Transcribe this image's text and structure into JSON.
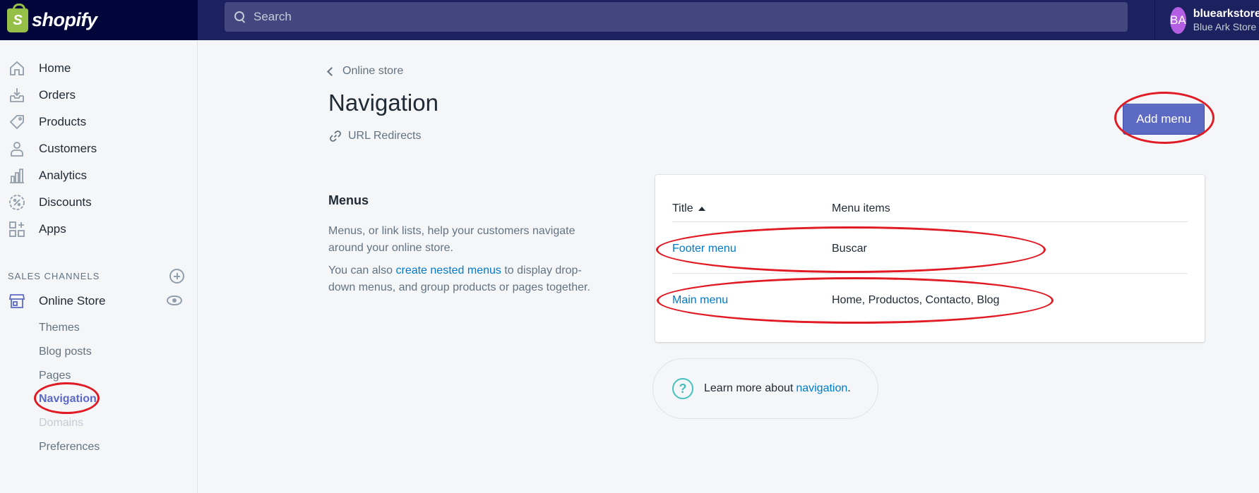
{
  "topbar": {
    "logo_letter": "S",
    "logo_text": "shopify",
    "search_placeholder": "Search",
    "account": {
      "initials": "BA",
      "name": "bluearkstore",
      "store": "Blue Ark Store"
    }
  },
  "sidebar": {
    "items": [
      {
        "label": "Home",
        "icon": "home-icon"
      },
      {
        "label": "Orders",
        "icon": "orders-icon"
      },
      {
        "label": "Products",
        "icon": "tag-icon"
      },
      {
        "label": "Customers",
        "icon": "person-icon"
      },
      {
        "label": "Analytics",
        "icon": "bar-chart-icon"
      },
      {
        "label": "Discounts",
        "icon": "discount-icon"
      },
      {
        "label": "Apps",
        "icon": "apps-icon"
      }
    ],
    "sales_channels_title": "SALES CHANNELS",
    "online_store_label": "Online Store",
    "sub_items": [
      {
        "label": "Themes"
      },
      {
        "label": "Blog posts"
      },
      {
        "label": "Pages"
      },
      {
        "label": "Navigation"
      },
      {
        "label": "Domains"
      },
      {
        "label": "Preferences"
      }
    ]
  },
  "main": {
    "breadcrumb": "Online store",
    "title": "Navigation",
    "url_redirects": "URL Redirects",
    "add_menu_label": "Add menu",
    "menus_section": {
      "title": "Menus",
      "desc1": "Menus, or link lists, help your customers navigate around your online store.",
      "desc2_pre": "You can also ",
      "desc2_link": "create nested menus",
      "desc2_post": " to display drop-down menus, and group products or pages together."
    },
    "table": {
      "col_title": "Title",
      "col_items": "Menu items",
      "rows": [
        {
          "title": "Footer menu",
          "items": "Buscar"
        },
        {
          "title": "Main menu",
          "items": "Home, Productos, Contacto, Blog"
        }
      ]
    },
    "learn_more": {
      "pre": "Learn more about",
      "link": "navigation",
      "post": "."
    }
  },
  "colors": {
    "topbar": "#1c2260",
    "accent": "#5c6ac4",
    "link": "#007ace",
    "annotation": "#e01b24"
  }
}
